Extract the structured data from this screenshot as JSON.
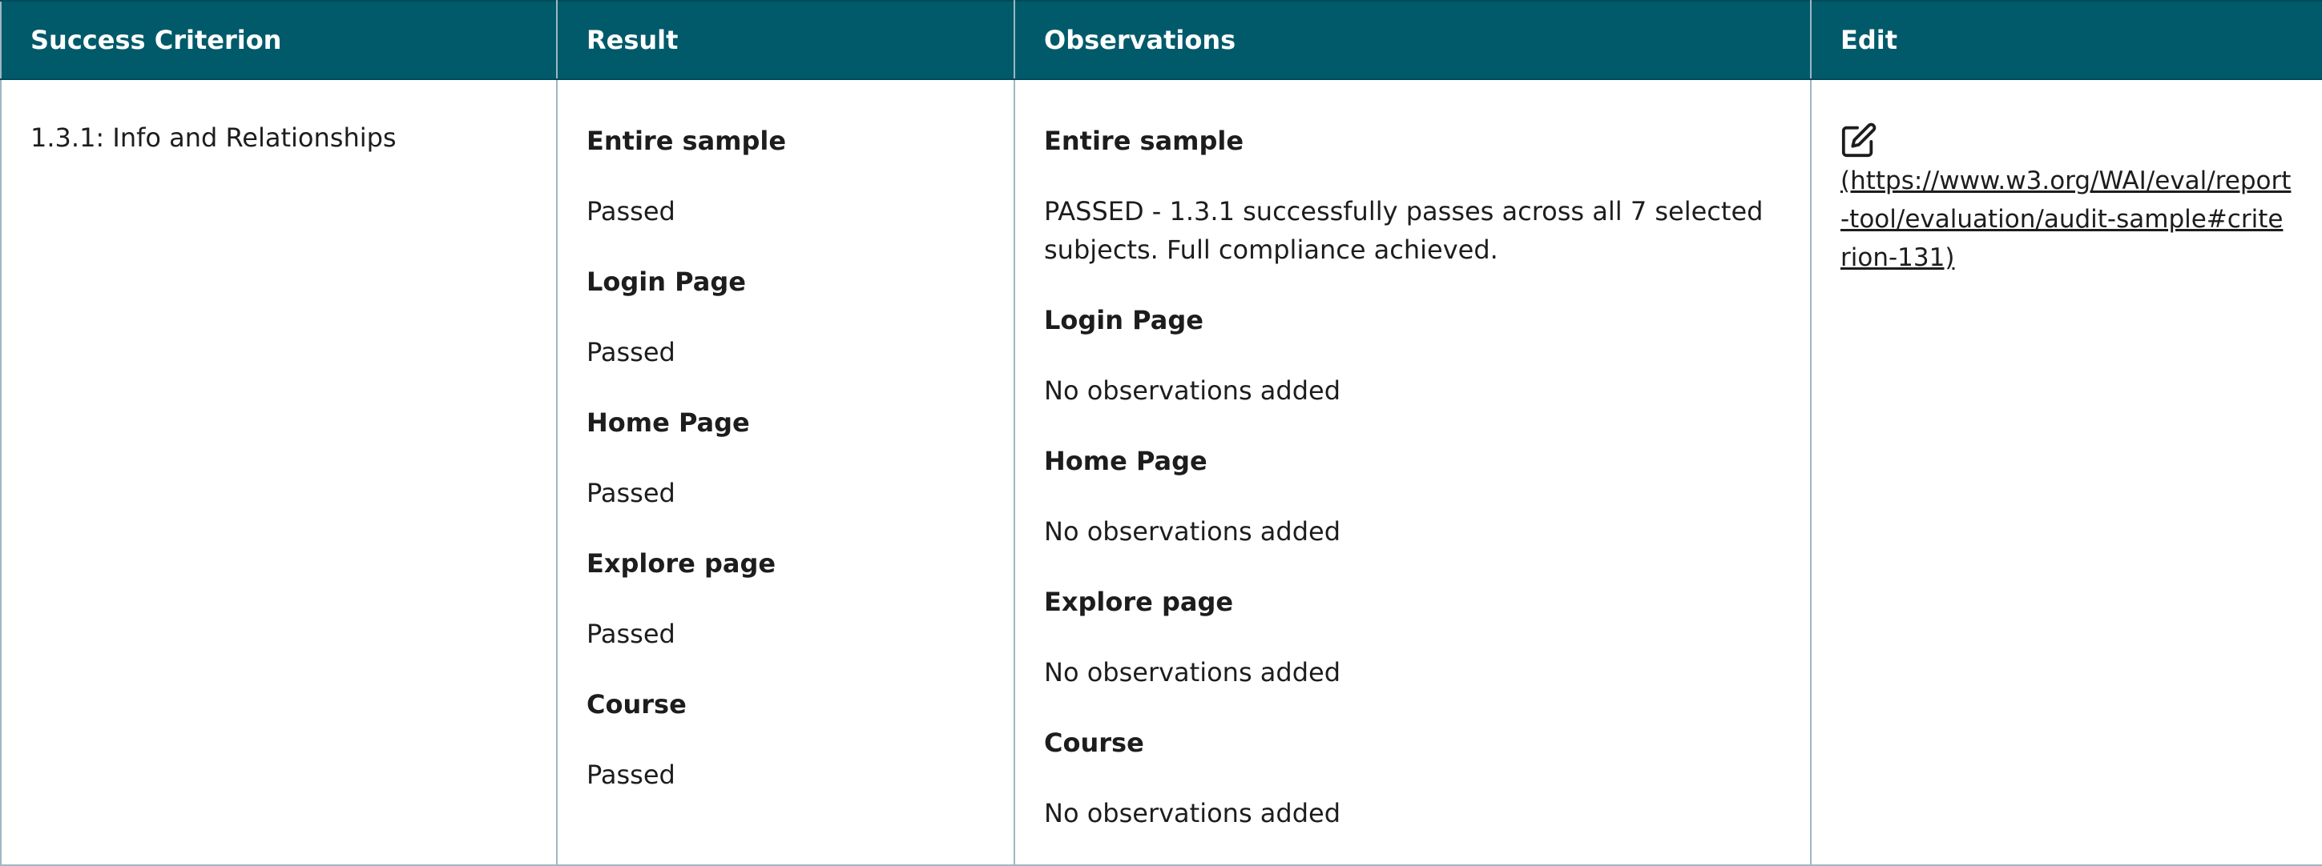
{
  "table": {
    "headers": {
      "criterion": "Success Criterion",
      "result": "Result",
      "observations": "Observations",
      "edit": "Edit"
    },
    "row": {
      "criterion": "1.3.1: Info and Relationships",
      "results": [
        {
          "heading": "Entire sample",
          "value": "Passed"
        },
        {
          "heading": "Login Page",
          "value": "Passed"
        },
        {
          "heading": "Home Page",
          "value": "Passed"
        },
        {
          "heading": "Explore page",
          "value": "Passed"
        },
        {
          "heading": "Course",
          "value": "Passed"
        }
      ],
      "observations": [
        {
          "heading": "Entire sample",
          "value": "PASSED - 1.3.1 successfully passes across all 7 selected subjects. Full compliance achieved."
        },
        {
          "heading": "Login Page",
          "value": "No observations added"
        },
        {
          "heading": "Home Page",
          "value": "No observations added"
        },
        {
          "heading": "Explore page",
          "value": "No observations added"
        },
        {
          "heading": "Course",
          "value": "No observations added"
        }
      ],
      "edit": {
        "icon": "edit-icon",
        "link_text": "(https://www.w3.org/WAI/eval/report-tool/evaluation/audit-sample#criterion-131)"
      }
    }
  },
  "colors": {
    "header_background": "#005a6a",
    "header_text": "#ffffff",
    "border": "#9fb6c6"
  }
}
